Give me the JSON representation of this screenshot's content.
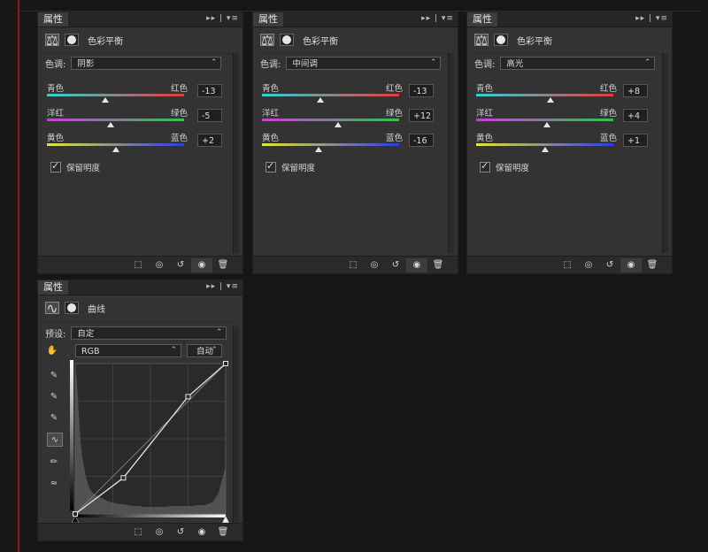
{
  "panels": [
    {
      "tab_label": "属性",
      "menu_icon": "▸▸ | ▾≡",
      "title": "色彩平衡",
      "tone_label": "色调:",
      "tone_value": "阴影",
      "sliders": [
        {
          "left": "青色",
          "right": "红色",
          "value": "-13",
          "pos": 0.435
        },
        {
          "left": "洋红",
          "right": "绿色",
          "value": "-5",
          "pos": 0.475
        },
        {
          "left": "黄色",
          "right": "蓝色",
          "value": "+2",
          "pos": 0.51
        }
      ],
      "preserve_label": "保留明度",
      "preserve_checked": true
    },
    {
      "tab_label": "属性",
      "menu_icon": "▸▸ | ▾≡",
      "title": "色彩平衡",
      "tone_label": "色调:",
      "tone_value": "中间调",
      "sliders": [
        {
          "left": "青色",
          "right": "红色",
          "value": "-13",
          "pos": 0.435
        },
        {
          "left": "洋红",
          "right": "绿色",
          "value": "+12",
          "pos": 0.56
        },
        {
          "left": "黄色",
          "right": "蓝色",
          "value": "-16",
          "pos": 0.42
        }
      ],
      "preserve_label": "保留明度",
      "preserve_checked": true
    },
    {
      "tab_label": "属性",
      "menu_icon": "▸▸ | ▾≡",
      "title": "色彩平衡",
      "tone_label": "色调:",
      "tone_value": "高光",
      "sliders": [
        {
          "left": "青色",
          "right": "红色",
          "value": "+8",
          "pos": 0.54
        },
        {
          "left": "洋红",
          "right": "绿色",
          "value": "+4",
          "pos": 0.52
        },
        {
          "left": "黄色",
          "right": "蓝色",
          "value": "+1",
          "pos": 0.505
        }
      ],
      "preserve_label": "保留明度",
      "preserve_checked": true
    }
  ],
  "curves": {
    "tab_label": "属性",
    "menu_icon": "▸▸ | ▾≡",
    "title": "曲线",
    "preset_label": "预设:",
    "preset_value": "自定",
    "channel_value": "RGB",
    "auto_label": "自动",
    "points": [
      [
        0.0,
        0.0
      ],
      [
        0.32,
        0.24
      ],
      [
        0.75,
        0.78
      ],
      [
        1.0,
        1.0
      ]
    ]
  },
  "footer_icons": [
    "clip-to-layer-icon",
    "view-previous-icon",
    "reset-icon",
    "visibility-eye-icon",
    "trash-icon"
  ],
  "colors": {
    "cyan": "#2fd3d6",
    "red": "#e33b3b",
    "magenta": "#c83fd8",
    "green": "#33c24a",
    "yellow": "#e9e43a",
    "blue": "#2a3ce0"
  }
}
